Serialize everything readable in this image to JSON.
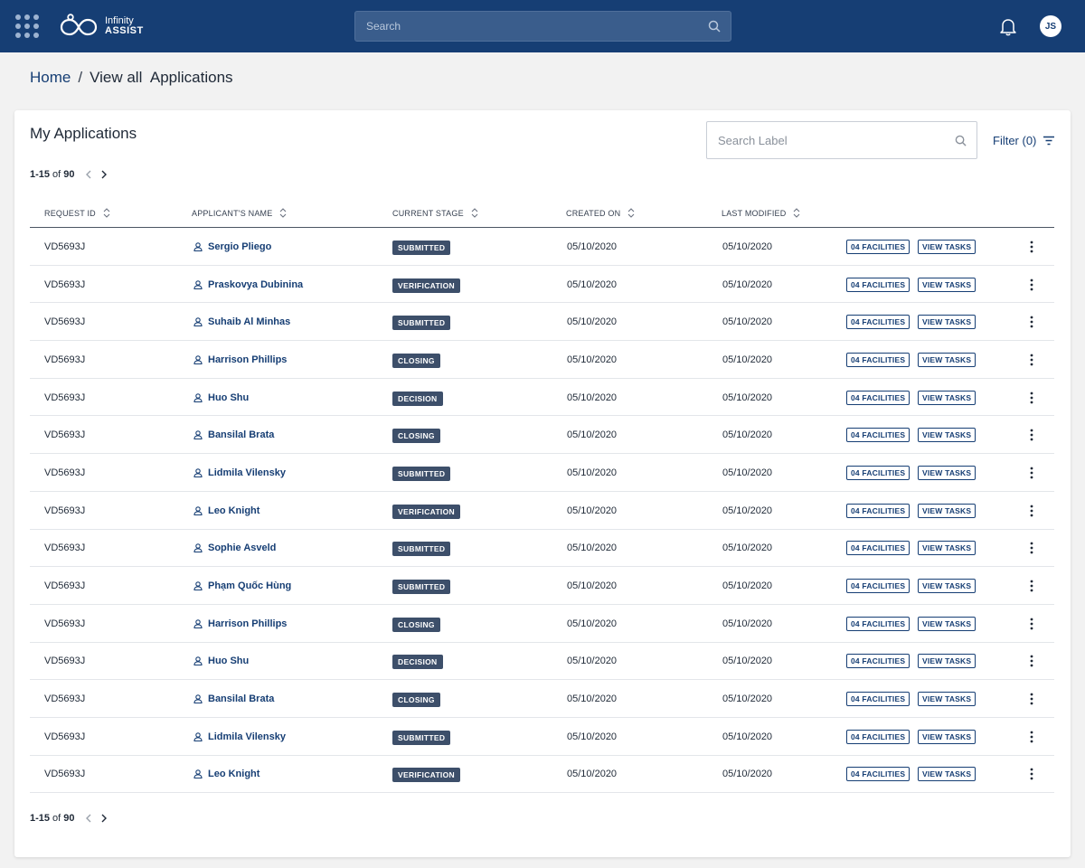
{
  "header": {
    "logo_line1": "Infinity",
    "logo_line2": "ASSIST",
    "search_placeholder": "Search",
    "user_initials": "JS",
    "brand_color": "#163e74"
  },
  "breadcrumb": {
    "home": "Home",
    "separator": "/",
    "current": "View all  Applications"
  },
  "card": {
    "title": "My Applications",
    "label_search_placeholder": "Search Label",
    "filter_label": "Filter (0)"
  },
  "pagination": {
    "range": "1-15",
    "of": "of",
    "total": "90"
  },
  "table": {
    "columns": [
      "REQUEST ID",
      "APPLICANT'S NAME",
      "CURRENT STAGE",
      "CREATED ON",
      "LAST MODIFIED"
    ],
    "facilities_label": "04 FACILITIES",
    "tasks_label": "VIEW TASKS",
    "rows": [
      {
        "id": "VD5693J",
        "name": "Sergio Pliego",
        "stage": "SUBMITTED",
        "created": "05/10/2020",
        "modified": "05/10/2020"
      },
      {
        "id": "VD5693J",
        "name": "Praskovya Dubinina",
        "stage": "VERIFICATION",
        "created": "05/10/2020",
        "modified": "05/10/2020"
      },
      {
        "id": "VD5693J",
        "name": "Suhaib Al Minhas",
        "stage": "SUBMITTED",
        "created": "05/10/2020",
        "modified": "05/10/2020"
      },
      {
        "id": "VD5693J",
        "name": "Harrison Phillips",
        "stage": "CLOSING",
        "created": "05/10/2020",
        "modified": "05/10/2020"
      },
      {
        "id": "VD5693J",
        "name": "Huo Shu",
        "stage": "DECISION",
        "created": "05/10/2020",
        "modified": "05/10/2020"
      },
      {
        "id": "VD5693J",
        "name": "Bansilal Brata",
        "stage": "CLOSING",
        "created": "05/10/2020",
        "modified": "05/10/2020"
      },
      {
        "id": "VD5693J",
        "name": "Lidmila Vilensky",
        "stage": "SUBMITTED",
        "created": "05/10/2020",
        "modified": "05/10/2020"
      },
      {
        "id": "VD5693J",
        "name": "Leo Knight",
        "stage": "VERIFICATION",
        "created": "05/10/2020",
        "modified": "05/10/2020"
      },
      {
        "id": "VD5693J",
        "name": "Sophie Asveld",
        "stage": "SUBMITTED",
        "created": "05/10/2020",
        "modified": "05/10/2020"
      },
      {
        "id": "VD5693J",
        "name": "Phạm Quốc Hùng",
        "stage": "SUBMITTED",
        "created": "05/10/2020",
        "modified": "05/10/2020"
      },
      {
        "id": "VD5693J",
        "name": "Harrison Phillips",
        "stage": "CLOSING",
        "created": "05/10/2020",
        "modified": "05/10/2020"
      },
      {
        "id": "VD5693J",
        "name": "Huo Shu",
        "stage": "DECISION",
        "created": "05/10/2020",
        "modified": "05/10/2020"
      },
      {
        "id": "VD5693J",
        "name": "Bansilal Brata",
        "stage": "CLOSING",
        "created": "05/10/2020",
        "modified": "05/10/2020"
      },
      {
        "id": "VD5693J",
        "name": "Lidmila Vilensky",
        "stage": "SUBMITTED",
        "created": "05/10/2020",
        "modified": "05/10/2020"
      },
      {
        "id": "VD5693J",
        "name": "Leo Knight",
        "stage": "VERIFICATION",
        "created": "05/10/2020",
        "modified": "05/10/2020"
      }
    ]
  }
}
